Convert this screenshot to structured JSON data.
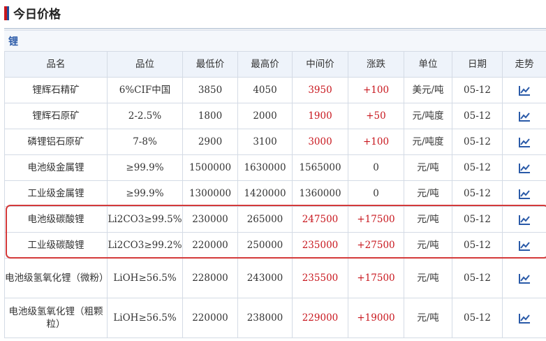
{
  "page_title": "今日价格",
  "section_label": "锂",
  "columns": [
    "品名",
    "品位",
    "最低价",
    "最高价",
    "中间价",
    "涨跌",
    "单位",
    "日期",
    "走势"
  ],
  "rows": [
    {
      "name": "锂辉石精矿",
      "grade": "6%CIF中国",
      "low": "3850",
      "high": "4050",
      "mid": "3950",
      "change": "+100",
      "unit": "美元/吨",
      "date": "05-12",
      "mid_red": true,
      "change_red": true
    },
    {
      "name": "锂辉石原矿",
      "grade": "2-2.5%",
      "low": "1800",
      "high": "2000",
      "mid": "1900",
      "change": "+50",
      "unit": "元/吨度",
      "date": "05-12",
      "mid_red": true,
      "change_red": true
    },
    {
      "name": "磷锂铝石原矿",
      "grade": "7-8%",
      "low": "2900",
      "high": "3100",
      "mid": "3000",
      "change": "+100",
      "unit": "元/吨度",
      "date": "05-12",
      "mid_red": true,
      "change_red": true
    },
    {
      "name": "电池级金属锂",
      "grade": "≥99.9%",
      "low": "1500000",
      "high": "1630000",
      "mid": "1565000",
      "change": "0",
      "unit": "元/吨",
      "date": "05-12",
      "mid_red": false,
      "change_red": false
    },
    {
      "name": "工业级金属锂",
      "grade": "≥99.9%",
      "low": "1300000",
      "high": "1420000",
      "mid": "1360000",
      "change": "0",
      "unit": "元/吨",
      "date": "05-12",
      "mid_red": false,
      "change_red": false
    },
    {
      "name": "电池级碳酸锂",
      "grade": "Li2CO3≥99.5%",
      "low": "230000",
      "high": "265000",
      "mid": "247500",
      "change": "+17500",
      "unit": "元/吨",
      "date": "05-12",
      "mid_red": true,
      "change_red": true
    },
    {
      "name": "工业级碳酸锂",
      "grade": "Li2CO3≥99.2%",
      "low": "220000",
      "high": "250000",
      "mid": "235000",
      "change": "+27500",
      "unit": "元/吨",
      "date": "05-12",
      "mid_red": true,
      "change_red": true
    },
    {
      "name": "电池级氢氧化锂（微粉）",
      "grade": "LiOH≥56.5%",
      "low": "228000",
      "high": "243000",
      "mid": "235500",
      "change": "+17500",
      "unit": "元/吨",
      "date": "05-12",
      "mid_red": true,
      "change_red": true,
      "tall": true
    },
    {
      "name": "电池级氢氧化锂（粗颗粒）",
      "grade": "LiOH≥56.5%",
      "low": "220000",
      "high": "238000",
      "mid": "229000",
      "change": "+19000",
      "unit": "元/吨",
      "date": "05-12",
      "mid_red": true,
      "change_red": true,
      "tall": true
    }
  ],
  "trend_icon": "trend-chart-icon",
  "colors": {
    "accent_red": "#c8161d",
    "accent_blue": "#2a5aa8",
    "header_bg": "#eef3fa"
  }
}
